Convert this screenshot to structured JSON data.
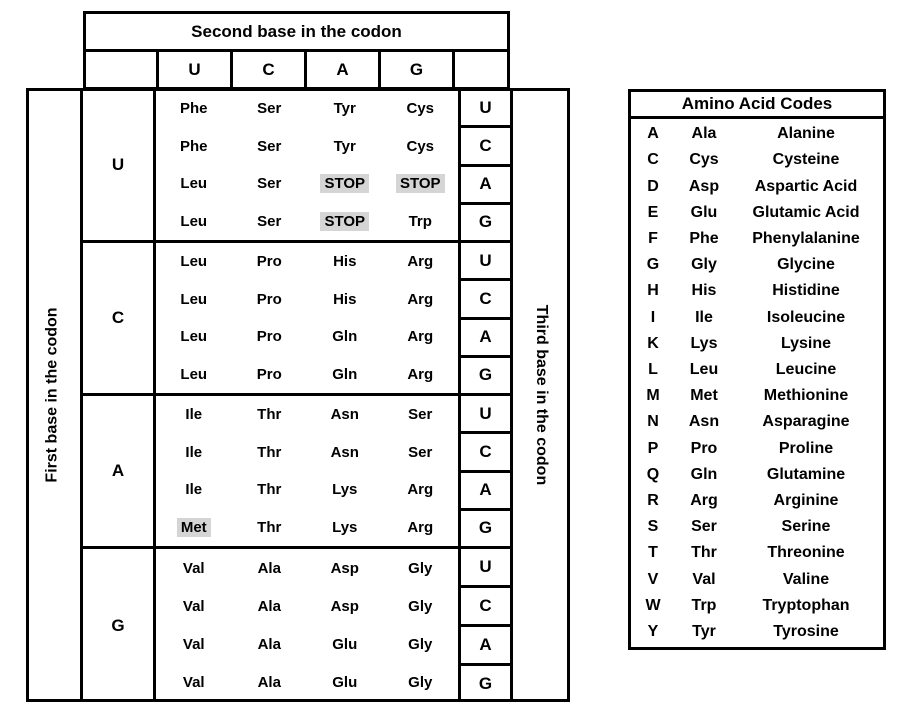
{
  "codon_table": {
    "second_base_header": "Second base in the codon",
    "first_base_label": "First base in the codon",
    "third_base_label": "Third base in the codon",
    "second_base_letters": [
      "U",
      "C",
      "A",
      "G"
    ],
    "third_base_letters": [
      "U",
      "C",
      "A",
      "G"
    ],
    "highlight_color": "#d5d5d5",
    "blocks": [
      {
        "first_base": "U",
        "rows": [
          {
            "third_base": "U",
            "cells": [
              {
                "text": "Phe",
                "highlight": false
              },
              {
                "text": "Ser",
                "highlight": false
              },
              {
                "text": "Tyr",
                "highlight": false
              },
              {
                "text": "Cys",
                "highlight": false
              }
            ]
          },
          {
            "third_base": "C",
            "cells": [
              {
                "text": "Phe",
                "highlight": false
              },
              {
                "text": "Ser",
                "highlight": false
              },
              {
                "text": "Tyr",
                "highlight": false
              },
              {
                "text": "Cys",
                "highlight": false
              }
            ]
          },
          {
            "third_base": "A",
            "cells": [
              {
                "text": "Leu",
                "highlight": false
              },
              {
                "text": "Ser",
                "highlight": false
              },
              {
                "text": "STOP",
                "highlight": true
              },
              {
                "text": "STOP",
                "highlight": true
              }
            ]
          },
          {
            "third_base": "G",
            "cells": [
              {
                "text": "Leu",
                "highlight": false
              },
              {
                "text": "Ser",
                "highlight": false
              },
              {
                "text": "STOP",
                "highlight": true
              },
              {
                "text": "Trp",
                "highlight": false
              }
            ]
          }
        ]
      },
      {
        "first_base": "C",
        "rows": [
          {
            "third_base": "U",
            "cells": [
              {
                "text": "Leu",
                "highlight": false
              },
              {
                "text": "Pro",
                "highlight": false
              },
              {
                "text": "His",
                "highlight": false
              },
              {
                "text": "Arg",
                "highlight": false
              }
            ]
          },
          {
            "third_base": "C",
            "cells": [
              {
                "text": "Leu",
                "highlight": false
              },
              {
                "text": "Pro",
                "highlight": false
              },
              {
                "text": "His",
                "highlight": false
              },
              {
                "text": "Arg",
                "highlight": false
              }
            ]
          },
          {
            "third_base": "A",
            "cells": [
              {
                "text": "Leu",
                "highlight": false
              },
              {
                "text": "Pro",
                "highlight": false
              },
              {
                "text": "Gln",
                "highlight": false
              },
              {
                "text": "Arg",
                "highlight": false
              }
            ]
          },
          {
            "third_base": "G",
            "cells": [
              {
                "text": "Leu",
                "highlight": false
              },
              {
                "text": "Pro",
                "highlight": false
              },
              {
                "text": "Gln",
                "highlight": false
              },
              {
                "text": "Arg",
                "highlight": false
              }
            ]
          }
        ]
      },
      {
        "first_base": "A",
        "rows": [
          {
            "third_base": "U",
            "cells": [
              {
                "text": "Ile",
                "highlight": false
              },
              {
                "text": "Thr",
                "highlight": false
              },
              {
                "text": "Asn",
                "highlight": false
              },
              {
                "text": "Ser",
                "highlight": false
              }
            ]
          },
          {
            "third_base": "C",
            "cells": [
              {
                "text": "Ile",
                "highlight": false
              },
              {
                "text": "Thr",
                "highlight": false
              },
              {
                "text": "Asn",
                "highlight": false
              },
              {
                "text": "Ser",
                "highlight": false
              }
            ]
          },
          {
            "third_base": "A",
            "cells": [
              {
                "text": "Ile",
                "highlight": false
              },
              {
                "text": "Thr",
                "highlight": false
              },
              {
                "text": "Lys",
                "highlight": false
              },
              {
                "text": "Arg",
                "highlight": false
              }
            ]
          },
          {
            "third_base": "G",
            "cells": [
              {
                "text": "Met",
                "highlight": true
              },
              {
                "text": "Thr",
                "highlight": false
              },
              {
                "text": "Lys",
                "highlight": false
              },
              {
                "text": "Arg",
                "highlight": false
              }
            ]
          }
        ]
      },
      {
        "first_base": "G",
        "rows": [
          {
            "third_base": "U",
            "cells": [
              {
                "text": "Val",
                "highlight": false
              },
              {
                "text": "Ala",
                "highlight": false
              },
              {
                "text": "Asp",
                "highlight": false
              },
              {
                "text": "Gly",
                "highlight": false
              }
            ]
          },
          {
            "third_base": "C",
            "cells": [
              {
                "text": "Val",
                "highlight": false
              },
              {
                "text": "Ala",
                "highlight": false
              },
              {
                "text": "Asp",
                "highlight": false
              },
              {
                "text": "Gly",
                "highlight": false
              }
            ]
          },
          {
            "third_base": "A",
            "cells": [
              {
                "text": "Val",
                "highlight": false
              },
              {
                "text": "Ala",
                "highlight": false
              },
              {
                "text": "Glu",
                "highlight": false
              },
              {
                "text": "Gly",
                "highlight": false
              }
            ]
          },
          {
            "third_base": "G",
            "cells": [
              {
                "text": "Val",
                "highlight": false
              },
              {
                "text": "Ala",
                "highlight": false
              },
              {
                "text": "Glu",
                "highlight": false
              },
              {
                "text": "Gly",
                "highlight": false
              }
            ]
          }
        ]
      }
    ]
  },
  "amino_acid_codes": {
    "title": "Amino Acid Codes",
    "rows": [
      {
        "letter": "A",
        "abbr": "Ala",
        "name": "Alanine"
      },
      {
        "letter": "C",
        "abbr": "Cys",
        "name": "Cysteine"
      },
      {
        "letter": "D",
        "abbr": "Asp",
        "name": "Aspartic Acid"
      },
      {
        "letter": "E",
        "abbr": "Glu",
        "name": "Glutamic Acid"
      },
      {
        "letter": "F",
        "abbr": "Phe",
        "name": "Phenylalanine"
      },
      {
        "letter": "G",
        "abbr": "Gly",
        "name": "Glycine"
      },
      {
        "letter": "H",
        "abbr": "His",
        "name": "Histidine"
      },
      {
        "letter": "I",
        "abbr": "Ile",
        "name": "Isoleucine"
      },
      {
        "letter": "K",
        "abbr": "Lys",
        "name": "Lysine"
      },
      {
        "letter": "L",
        "abbr": "Leu",
        "name": "Leucine"
      },
      {
        "letter": "M",
        "abbr": "Met",
        "name": "Methionine"
      },
      {
        "letter": "N",
        "abbr": "Asn",
        "name": "Asparagine"
      },
      {
        "letter": "P",
        "abbr": "Pro",
        "name": "Proline"
      },
      {
        "letter": "Q",
        "abbr": "Gln",
        "name": "Glutamine"
      },
      {
        "letter": "R",
        "abbr": "Arg",
        "name": "Arginine"
      },
      {
        "letter": "S",
        "abbr": "Ser",
        "name": "Serine"
      },
      {
        "letter": "T",
        "abbr": "Thr",
        "name": "Threonine"
      },
      {
        "letter": "V",
        "abbr": "Val",
        "name": "Valine"
      },
      {
        "letter": "W",
        "abbr": "Trp",
        "name": "Tryptophan"
      },
      {
        "letter": "Y",
        "abbr": "Tyr",
        "name": "Tyrosine"
      }
    ]
  }
}
